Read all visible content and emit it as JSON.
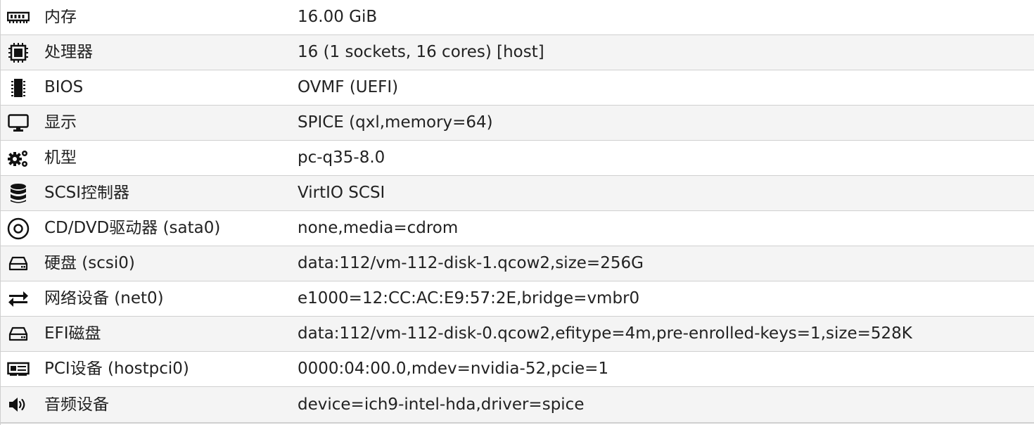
{
  "hardware": {
    "rows": [
      {
        "icon": "memory-icon",
        "label": "内存",
        "value": "16.00 GiB"
      },
      {
        "icon": "cpu-icon",
        "label": "处理器",
        "value": "16 (1 sockets, 16 cores) [host]"
      },
      {
        "icon": "bios-chip-icon",
        "label": "BIOS",
        "value": "OVMF (UEFI)"
      },
      {
        "icon": "monitor-icon",
        "label": "显示",
        "value": "SPICE (qxl,memory=64)"
      },
      {
        "icon": "gears-icon",
        "label": "机型",
        "value": "pc-q35-8.0"
      },
      {
        "icon": "database-icon",
        "label": "SCSI控制器",
        "value": "VirtIO SCSI"
      },
      {
        "icon": "cdrom-icon",
        "label": "CD/DVD驱动器 (sata0)",
        "value": "none,media=cdrom"
      },
      {
        "icon": "hard-drive-icon",
        "label": "硬盘 (scsi0)",
        "value": "data:112/vm-112-disk-1.qcow2,size=256G"
      },
      {
        "icon": "exchange-arrows-icon",
        "label": "网络设备 (net0)",
        "value": "e1000=12:CC:AC:E9:57:2E,bridge=vmbr0"
      },
      {
        "icon": "hard-drive-icon",
        "label": "EFI磁盘",
        "value": "data:112/vm-112-disk-0.qcow2,efitype=4m,pre-enrolled-keys=1,size=528K"
      },
      {
        "icon": "pci-card-icon",
        "label": "PCI设备 (hostpci0)",
        "value": "0000:04:00.0,mdev=nvidia-52,pcie=1"
      },
      {
        "icon": "speaker-icon",
        "label": "音频设备",
        "value": "device=ich9-intel-hda,driver=spice"
      }
    ]
  }
}
